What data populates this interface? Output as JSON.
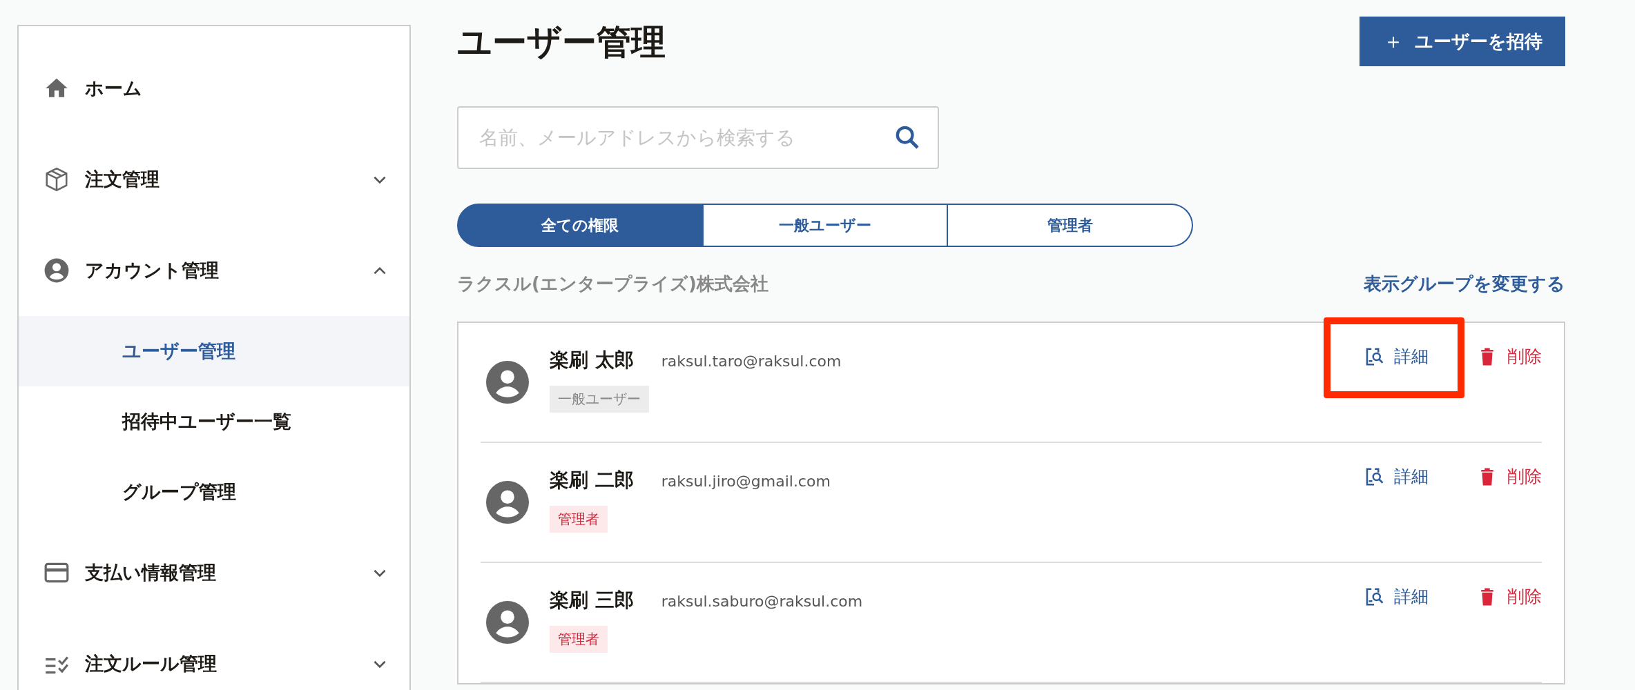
{
  "sidebar": {
    "items": [
      {
        "label": "ホーム"
      },
      {
        "label": "注文管理",
        "expanded": false
      },
      {
        "label": "アカウント管理",
        "expanded": true,
        "children": [
          {
            "label": "ユーザー管理",
            "selected": true
          },
          {
            "label": "招待中ユーザー一覧",
            "selected": false
          },
          {
            "label": "グループ管理",
            "selected": false
          }
        ]
      },
      {
        "label": "支払い情報管理",
        "expanded": false
      },
      {
        "label": "注文ルール管理",
        "expanded": false
      }
    ]
  },
  "page": {
    "title": "ユーザー管理",
    "invite_button": {
      "icon": "＋",
      "label": "ユーザーを招待"
    }
  },
  "search": {
    "placeholder": "名前、メールアドレスから検索する"
  },
  "filter_tabs": [
    {
      "label": "全ての権限",
      "selected": true
    },
    {
      "label": "一般ユーザー",
      "selected": false
    },
    {
      "label": "管理者",
      "selected": false
    }
  ],
  "group": {
    "name": "ラクスル(エンタープライズ)株式会社",
    "change_link": "表示グループを変更する"
  },
  "users": [
    {
      "name": "楽刷 太郎",
      "email": "raksul.taro@raksul.com",
      "role": {
        "kind": "general",
        "label": "一般ユーザー"
      },
      "detail": "詳細",
      "delete": "削除",
      "highlighted": true
    },
    {
      "name": "楽刷 二郎",
      "email": "raksul.jiro@gmail.com",
      "role": {
        "kind": "admin",
        "label": "管理者"
      },
      "detail": "詳細",
      "delete": "削除",
      "highlighted": false
    },
    {
      "name": "楽刷 三郎",
      "email": "raksul.saburo@raksul.com",
      "role": {
        "kind": "admin",
        "label": "管理者"
      },
      "detail": "詳細",
      "delete": "削除",
      "highlighted": false
    }
  ]
}
